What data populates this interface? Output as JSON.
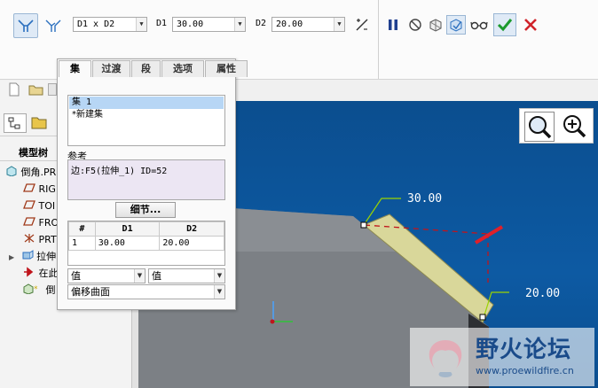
{
  "dashboard": {
    "dim_scheme": "D1 x D2",
    "d1_label": "D1",
    "d1_value": "30.00",
    "d2_label": "D2",
    "d2_value": "20.00"
  },
  "panel": {
    "tabs": [
      "集",
      "过渡",
      "段",
      "选项",
      "属性"
    ],
    "sets": [
      "集 1",
      "*新建集"
    ],
    "reference_label": "参考",
    "reference_value": "边:F5(拉伸_1) ID=52",
    "details_button": "细节...",
    "table": {
      "headers": [
        "#",
        "D1",
        "D2"
      ],
      "rows": [
        [
          "1",
          "30.00",
          "20.00"
        ]
      ]
    },
    "value_type_1": "值",
    "value_type_2": "值",
    "method": "偏移曲面"
  },
  "model_tree": {
    "title": "模型树",
    "items": [
      "倒角.PR",
      "RIG",
      "TOI",
      "FRO",
      "PRT",
      "拉伸",
      "在此",
      "倒"
    ]
  },
  "viewport": {
    "dim1": "30.00",
    "dim2": "20.00"
  },
  "watermark": {
    "title": "野火论坛",
    "url": "www.proewildfire.cn"
  },
  "colors": {
    "confirm": "#1c9a2e",
    "cancel": "#d0232a",
    "viewport_blue": "#0d5aa3",
    "face_yellow": "#d9d79a"
  }
}
